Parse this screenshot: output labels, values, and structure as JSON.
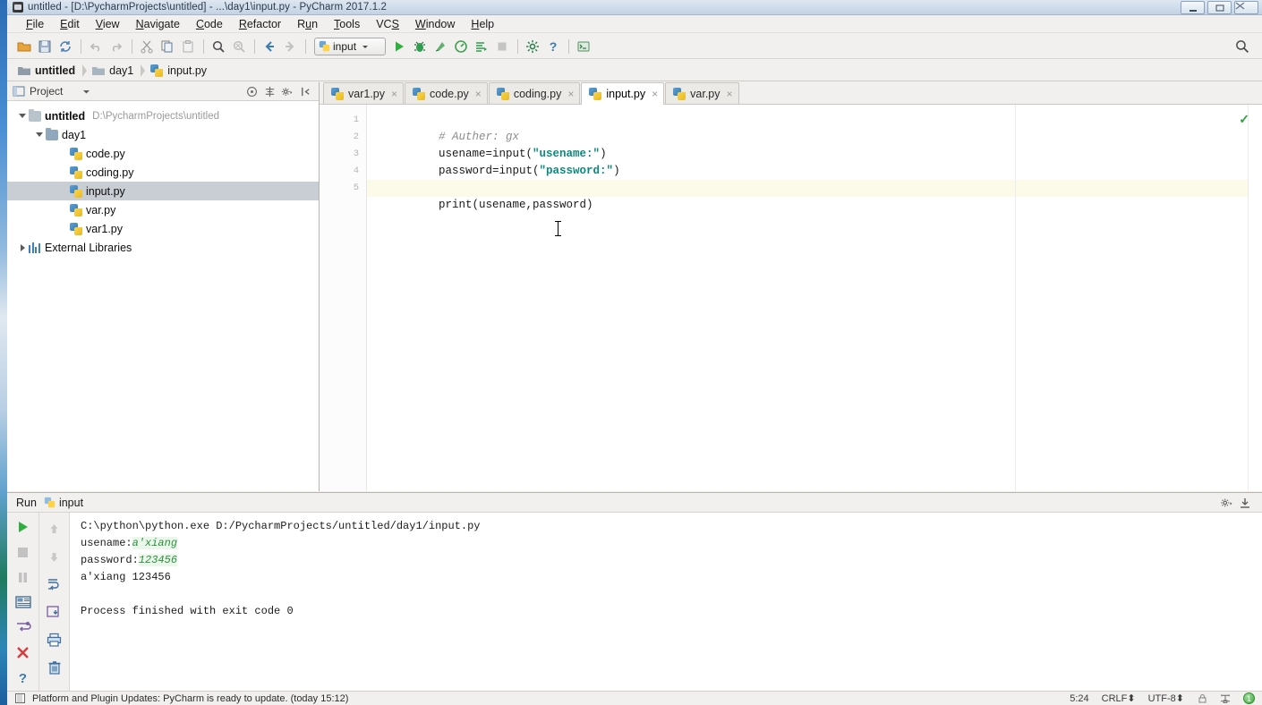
{
  "window": {
    "title": "untitled - [D:\\PycharmProjects\\untitled] - ...\\day1\\input.py - PyCharm 2017.1.2",
    "icon": "pycharm-icon",
    "controls": {
      "minimize": "minimize",
      "maximize": "maximize",
      "close": "close"
    }
  },
  "menubar": {
    "items": [
      {
        "label": "File",
        "mnemonic": "F"
      },
      {
        "label": "Edit",
        "mnemonic": "E"
      },
      {
        "label": "View",
        "mnemonic": "V"
      },
      {
        "label": "Navigate",
        "mnemonic": "N"
      },
      {
        "label": "Code",
        "mnemonic": "C"
      },
      {
        "label": "Refactor",
        "mnemonic": "R"
      },
      {
        "label": "Run",
        "mnemonic": "u"
      },
      {
        "label": "Tools",
        "mnemonic": "T"
      },
      {
        "label": "VCS",
        "mnemonic": "S"
      },
      {
        "label": "Window",
        "mnemonic": "W"
      },
      {
        "label": "Help",
        "mnemonic": "H"
      }
    ]
  },
  "toolbar": {
    "buttons": [
      "open-folder-icon",
      "save-all-icon",
      "sync-icon",
      "undo-icon",
      "redo-icon",
      "cut-icon",
      "copy-icon",
      "paste-icon",
      "find-icon",
      "replace-icon",
      "back-icon",
      "forward-icon"
    ],
    "run_config": {
      "name": "input",
      "icon": "python-config-icon",
      "dropdown": "chevron-down-icon"
    },
    "actions": [
      "run-icon",
      "debug-icon",
      "coverage-icon",
      "profile-icon",
      "run-with-console-icon",
      "stop-icon",
      "settings-icon",
      "help-icon",
      "python-console-icon"
    ],
    "search_icon": "search-everywhere-icon"
  },
  "breadcrumb": {
    "items": [
      {
        "label": "untitled",
        "icon": "folder-icon",
        "bold": true
      },
      {
        "label": "day1",
        "icon": "folder-icon",
        "bold": false
      },
      {
        "label": "input.py",
        "icon": "python-file-icon",
        "bold": false
      }
    ]
  },
  "project_panel": {
    "title": "Project",
    "dropdown": "chevron-down-icon",
    "tools": [
      "collapse-all-icon",
      "target-icon",
      "settings-gear-icon",
      "hide-icon"
    ],
    "tree": [
      {
        "label": "untitled",
        "path": "D:\\PycharmProjects\\untitled",
        "icon": "folder-icon",
        "indent": 0,
        "twist": "open",
        "bold": true,
        "selected": false
      },
      {
        "label": "day1",
        "path": "",
        "icon": "folder-blue-icon",
        "indent": 1,
        "twist": "open",
        "bold": false,
        "selected": false
      },
      {
        "label": "code.py",
        "path": "",
        "icon": "python-file-icon",
        "indent": 2,
        "twist": "none",
        "bold": false,
        "selected": false
      },
      {
        "label": "coding.py",
        "path": "",
        "icon": "python-file-icon",
        "indent": 2,
        "twist": "none",
        "bold": false,
        "selected": false
      },
      {
        "label": "input.py",
        "path": "",
        "icon": "python-file-icon",
        "indent": 2,
        "twist": "none",
        "bold": false,
        "selected": true
      },
      {
        "label": "var.py",
        "path": "",
        "icon": "python-file-icon",
        "indent": 2,
        "twist": "none",
        "bold": false,
        "selected": false
      },
      {
        "label": "var1.py",
        "path": "",
        "icon": "python-file-icon",
        "indent": 2,
        "twist": "none",
        "bold": false,
        "selected": false
      },
      {
        "label": "External Libraries",
        "path": "",
        "icon": "library-icon",
        "indent": 0,
        "twist": "closed",
        "bold": false,
        "selected": false
      }
    ]
  },
  "editor": {
    "tabs": [
      {
        "label": "var1.py",
        "icon": "python-file-icon",
        "active": false,
        "close": "×"
      },
      {
        "label": "code.py",
        "icon": "python-file-icon",
        "active": false,
        "close": "×"
      },
      {
        "label": "coding.py",
        "icon": "python-file-icon",
        "active": false,
        "close": "×"
      },
      {
        "label": "input.py",
        "icon": "python-file-icon",
        "active": true,
        "close": "×"
      },
      {
        "label": "var.py",
        "icon": "python-file-icon",
        "active": false,
        "close": "×"
      }
    ],
    "line_numbers": [
      "1",
      "2",
      "3",
      "4",
      "5"
    ],
    "lines": [
      {
        "n": "1",
        "highlight": false,
        "tokens": [
          {
            "t": "# Auther: gx",
            "k": "comment"
          }
        ]
      },
      {
        "n": "2",
        "highlight": false,
        "tokens": [
          {
            "t": "usename=input(",
            "k": "plain"
          },
          {
            "t": "\"usename:\"",
            "k": "string"
          },
          {
            "t": ")",
            "k": "plain"
          }
        ]
      },
      {
        "n": "3",
        "highlight": false,
        "tokens": [
          {
            "t": "password=input(",
            "k": "plain"
          },
          {
            "t": "\"password:\"",
            "k": "string"
          },
          {
            "t": ")",
            "k": "plain"
          }
        ]
      },
      {
        "n": "4",
        "highlight": false,
        "tokens": [
          {
            "t": "",
            "k": "plain"
          }
        ]
      },
      {
        "n": "5",
        "highlight": true,
        "tokens": [
          {
            "t": "print(usename,password)",
            "k": "plain"
          }
        ]
      }
    ],
    "inspection_status": "✓",
    "inspection_name": "no-errors-check-icon"
  },
  "run_panel": {
    "title": "Run",
    "config_name": "input",
    "config_icon": "python-config-icon",
    "header_tools": [
      "settings-gear-icon",
      "hide-panel-icon"
    ],
    "side_buttons": [
      "rerun-icon",
      "stop-icon",
      "pause-icon",
      "console-icon",
      "soft-wrap-icon",
      "close-icon",
      "help-icon"
    ],
    "side_buttons2": [
      "up-arrow-icon",
      "down-arrow-icon",
      "soft-wrap-icon",
      "scroll-end-icon",
      "print-icon",
      "trash-icon"
    ],
    "console": [
      {
        "type": "plain",
        "text": "C:\\python\\python.exe D:/PycharmProjects/untitled/day1/input.py"
      },
      {
        "type": "prompt",
        "label": "usename:",
        "value": "a'xiang"
      },
      {
        "type": "prompt",
        "label": "password:",
        "value": "123456"
      },
      {
        "type": "plain",
        "text": "a'xiang 123456"
      },
      {
        "type": "plain",
        "text": ""
      },
      {
        "type": "plain",
        "text": "Process finished with exit code 0"
      }
    ]
  },
  "statusbar": {
    "icon": "message-icon",
    "message": "Platform and Plugin Updates: PyCharm is ready to update. (today 15:12)",
    "caret_position": "5:24",
    "line_separator": "CRLF⬍",
    "encoding": "UTF-8⬍",
    "lock_icon": "lock-icon",
    "branch_icon": "vcs-icon",
    "notification_count": "1"
  },
  "colors": {
    "accent": "#3a7bb0",
    "string": "#0c8a7d",
    "comment": "#8c8c8c",
    "console_input": "#2f8f3f",
    "selection": "#c9ced4",
    "highlight_line": "#fcfae8",
    "chrome": "#f1f0ee"
  }
}
